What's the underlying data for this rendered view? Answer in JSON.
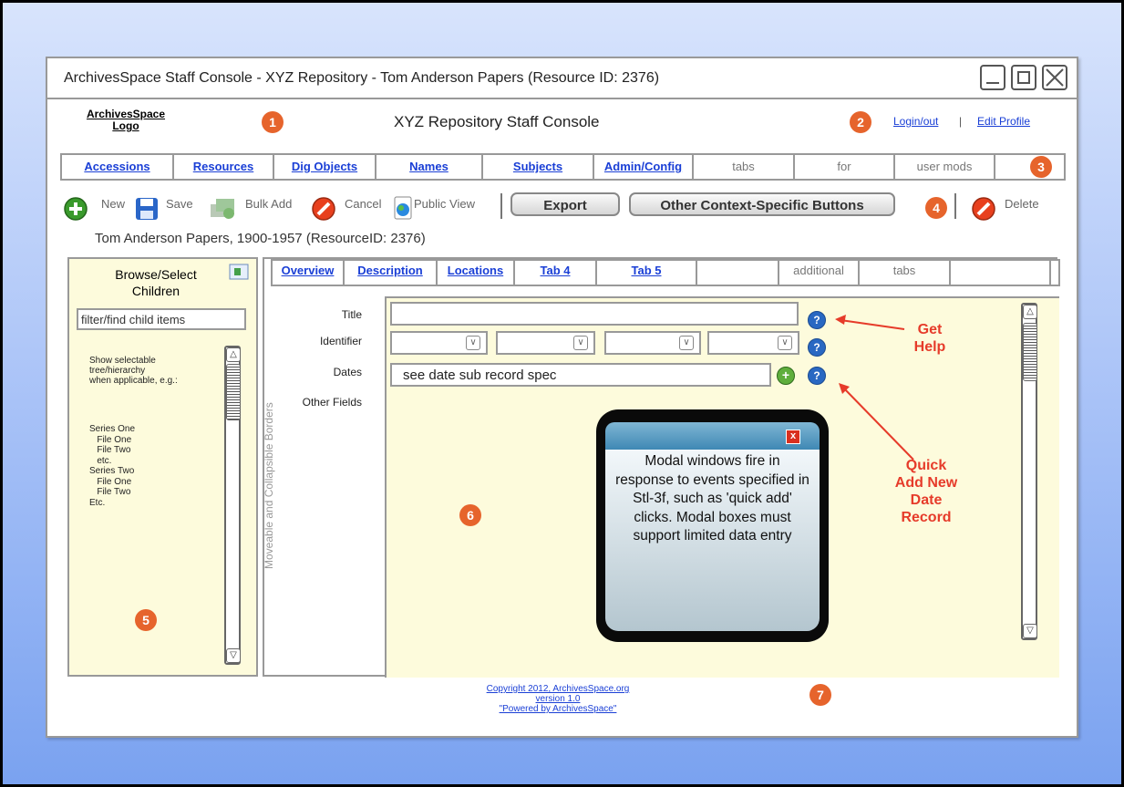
{
  "window": {
    "title": "ArchivesSpace Staff Console - XYZ Repository - Tom Anderson Papers (Resource ID: 2376)"
  },
  "header": {
    "logo": "ArchivesSpace\nLogo",
    "console_title": "XYZ Repository Staff Console",
    "login_link": "Login/out",
    "separator": "|",
    "edit_profile_link": "Edit Profile"
  },
  "badges": [
    "1",
    "2",
    "3",
    "4",
    "5",
    "6",
    "7"
  ],
  "main_tabs": [
    {
      "label": "Accessions",
      "style": "link"
    },
    {
      "label": "Resources",
      "style": "link"
    },
    {
      "label": "Dig Objects",
      "style": "link"
    },
    {
      "label": "Names",
      "style": "link"
    },
    {
      "label": "Subjects",
      "style": "link"
    },
    {
      "label": "Admin/Config",
      "style": "link"
    },
    {
      "label": "tabs",
      "style": "plain"
    },
    {
      "label": "for",
      "style": "plain"
    },
    {
      "label": "user mods",
      "style": "plain"
    }
  ],
  "toolbar": {
    "new": "New",
    "save": "Save",
    "bulk_add": "Bulk Add",
    "cancel": "Cancel",
    "public_view": "Public View",
    "export": "Export",
    "other_buttons": "Other Context-Specific Buttons",
    "delete": "Delete"
  },
  "record_heading": "Tom Anderson Papers, 1900-1957 (ResourceID: 2376)",
  "browse_panel": {
    "title": "Browse/Select\nChildren",
    "filter_placeholder": "filter/find child items",
    "note": "Show selectable\ntree/hierarchy\nwhen applicable, e.g.:",
    "tree": "Series One\n   File One\n   File Two\n   etc.\nSeries Two\n   File One\n   File Two\nEtc."
  },
  "record_tabs": [
    {
      "label": "Overview",
      "style": "link"
    },
    {
      "label": "Description",
      "style": "link"
    },
    {
      "label": "Locations",
      "style": "link"
    },
    {
      "label": "Tab 4",
      "style": "link"
    },
    {
      "label": "Tab 5",
      "style": "link"
    },
    {
      "label": "",
      "style": "plain"
    },
    {
      "label": "additional",
      "style": "plain"
    },
    {
      "label": "tabs",
      "style": "plain"
    },
    {
      "label": "",
      "style": "plain"
    }
  ],
  "borders_label": "Moveable and Collapsible Borders",
  "form": {
    "title_label": "Title",
    "identifier_label": "Identifier",
    "dates_label": "Dates",
    "dates_value": "see date sub record spec",
    "other_fields_label": "Other Fields",
    "help_glyph": "?",
    "add_glyph": "+"
  },
  "annotations": {
    "get_help": "Get\nHelp",
    "quick_add": "Quick\nAdd New\nDate\nRecord"
  },
  "modal": {
    "close_glyph": "x",
    "text": "Modal windows fire in response to events specified in Stl-3f, such as 'quick add' clicks. Modal boxes must support limited data entry"
  },
  "footer": {
    "copyright": "Copyright 2012, ArchivesSpace.org",
    "version": "version 1.0",
    "powered": "\"Powered by ArchivesSpace\""
  },
  "colors": {
    "link": "#1a3fd6",
    "badge": "#e6642c",
    "annotation": "#e63b2a",
    "panel_bg": "#fdfbdc",
    "help": "#2968c2"
  },
  "icons": [
    "plus-circle-icon",
    "floppy-disk-icon",
    "bulk-add-icon",
    "cancel-icon",
    "public-view-icon",
    "delete-icon",
    "minimize-icon",
    "maximize-icon",
    "close-icon",
    "help-icon",
    "add-date-icon",
    "modal-close-icon",
    "panel-toggle-icon",
    "scroll-up-icon",
    "scroll-down-icon"
  ]
}
